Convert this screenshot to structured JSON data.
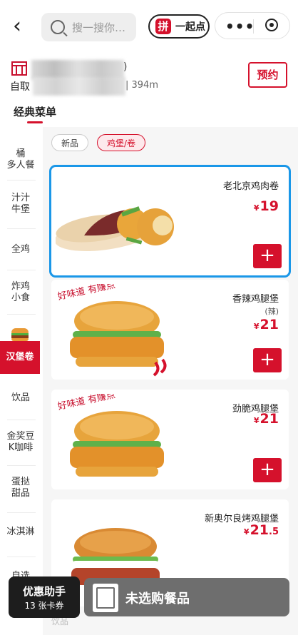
{
  "header": {
    "search_placeholder": "搜一搜你…",
    "pin_logo": "拼",
    "pin_label": "一起点",
    "capsule_dots": "•••"
  },
  "store": {
    "pickup": "自取",
    "paren": ")",
    "distance": "| 394m",
    "reserve_label": "预约"
  },
  "menu_tab": "经典菜单",
  "sidebar": {
    "items": [
      "桶\n多人餐",
      "汁汁\n牛堡",
      "全鸡",
      "炸鸡\n小食",
      "汉堡卷",
      "饮品",
      "金奖豆\nK咖啡",
      "蛋挞\n甜品",
      "冰淇淋",
      "自选"
    ]
  },
  "chips": [
    "新品",
    "鸡堡/卷"
  ],
  "products": [
    {
      "name": "老北京鸡肉卷",
      "sub": "",
      "currency": "¥",
      "price": "19",
      "decimal": ""
    },
    {
      "name": "香辣鸡腿堡",
      "sub": "(辣)",
      "currency": "¥",
      "price": "21",
      "decimal": ""
    },
    {
      "name": "劲脆鸡腿堡",
      "sub": "",
      "currency": "¥",
      "price": "21",
      "decimal": ""
    },
    {
      "name": "新奥尔良烤鸡腿堡",
      "sub": "",
      "currency": "¥",
      "price": "21",
      "decimal": ".5"
    }
  ],
  "add_symbol": "+",
  "promo_tag": "好味道 有赚点",
  "cart": {
    "coupon_title": "优惠助手",
    "coupon_sub": "13 张卡券",
    "empty_label": "未选购餐品"
  },
  "faint_bottom": "饮品",
  "colors": {
    "brand_red": "#d5112c",
    "selected_outline": "#1a97e8"
  }
}
